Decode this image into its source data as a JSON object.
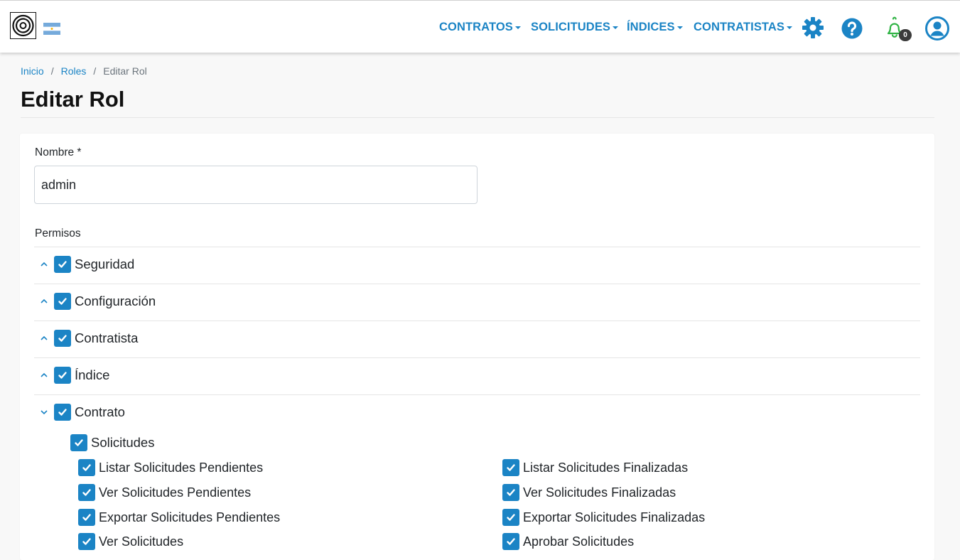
{
  "navbar": {
    "menu": [
      {
        "label": "CONTRATOS"
      },
      {
        "label": "SOLICITUDES"
      },
      {
        "label": "ÍNDICES"
      },
      {
        "label": "CONTRATISTAS"
      }
    ],
    "icons": [
      "gear-icon",
      "help-icon",
      "bell-icon",
      "user-icon"
    ],
    "notification_count": "0",
    "accent_color": "#1b84c5",
    "bell_color": "#2fb344"
  },
  "breadcrumb": {
    "items": [
      "Inicio",
      "Roles"
    ],
    "current": "Editar Rol",
    "separator": "/"
  },
  "page": {
    "title": "Editar Rol"
  },
  "form": {
    "nombre_label": "Nombre *",
    "nombre_value": "admin",
    "permisos_label": "Permisos"
  },
  "permissions": {
    "groups": [
      {
        "label": "Seguridad",
        "checked": true,
        "expanded": false
      },
      {
        "label": "Configuración",
        "checked": true,
        "expanded": false
      },
      {
        "label": "Contratista",
        "checked": true,
        "expanded": false
      },
      {
        "label": "Índice",
        "checked": true,
        "expanded": false
      },
      {
        "label": "Contrato",
        "checked": true,
        "expanded": true
      }
    ],
    "subgroup": {
      "label": "Solicitudes",
      "checked": true
    },
    "items_left": [
      "Listar Solicitudes Pendientes",
      "Ver Solicitudes Pendientes",
      "Exportar Solicitudes Pendientes",
      "Ver Solicitudes"
    ],
    "items_right": [
      "Listar Solicitudes Finalizadas",
      "Ver Solicitudes Finalizadas",
      "Exportar Solicitudes Finalizadas",
      "Aprobar Solicitudes"
    ]
  }
}
